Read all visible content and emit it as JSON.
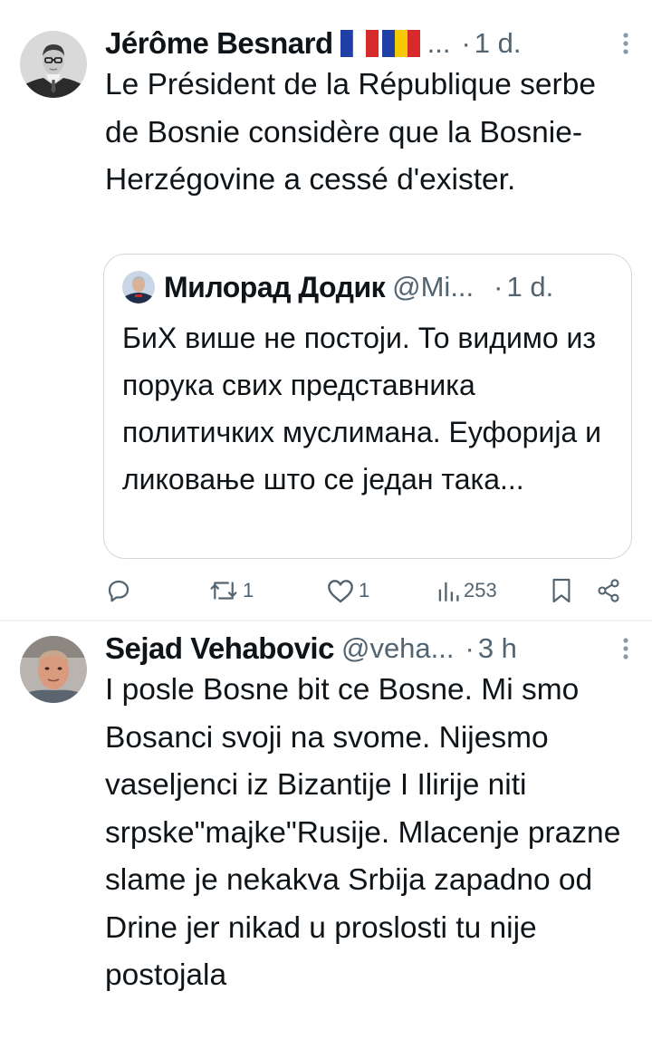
{
  "tweets": [
    {
      "author": "Jérôme Besnard",
      "flags": "🇫🇷🇷🇴",
      "handle": "...",
      "dot": "·",
      "time": "1 d.",
      "text": "Le Président de la République serbe de Bosnie considère que la Bosnie-Herzégovine a cessé d'exister.",
      "quote": {
        "author": "Милорад Додик",
        "handle": "@Mi...",
        "dot": "·",
        "time": "1 d.",
        "text": "БиХ више не постоји. То видимо из порука свих представника политичких муслимана. Еуфорија и ликовање што се један така..."
      },
      "actions": {
        "replies": "",
        "reposts": "1",
        "likes": "1",
        "views": "253"
      }
    },
    {
      "author": "Sejad Vehabovic",
      "handle": "@veha...",
      "dot": "·",
      "time": "3 h",
      "text": "I posle Bosne bit ce Bosne. Mi smo Bosanci svoji na svome. Nijesmo vaseljenci iz Bizantije I Ilirije niti srpske\"majke\"Rusije. Mlacenje prazne slame je nekakva Srbija zapadno od Drine jer nikad u proslosti tu nije postojala"
    }
  ],
  "colors": {
    "text": "#0f1419",
    "secondary": "#536471",
    "border": "#cfd9de",
    "divider": "#eff3f4"
  }
}
